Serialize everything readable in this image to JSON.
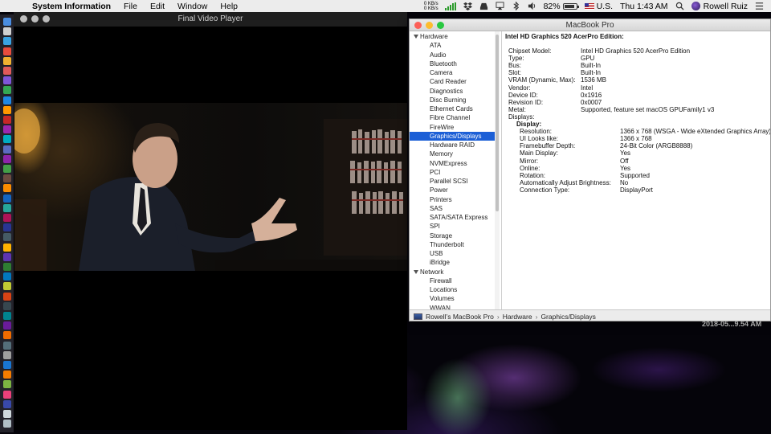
{
  "menubar": {
    "app_name": "System Information",
    "menus": [
      "File",
      "Edit",
      "Window",
      "Help"
    ],
    "net_up": "0 KB/s",
    "net_down": "0 KB/s",
    "battery": "82%",
    "input_source": "U.S.",
    "clock": "Thu 1:43 AM",
    "user": "Rowell Ruiz"
  },
  "video_player": {
    "title": "Final Video Player"
  },
  "sysinfo": {
    "window_title": "MacBook Pro",
    "sidebar": {
      "hardware_label": "Hardware",
      "hardware_items": [
        "ATA",
        "Audio",
        "Bluetooth",
        "Camera",
        "Card Reader",
        "Diagnostics",
        "Disc Burning",
        "Ethernet Cards",
        "Fibre Channel",
        "FireWire",
        "Graphics/Displays",
        "Hardware RAID",
        "Memory",
        "NVMExpress",
        "PCI",
        "Parallel SCSI",
        "Power",
        "Printers",
        "SAS",
        "SATA/SATA Express",
        "SPI",
        "Storage",
        "Thunderbolt",
        "USB",
        "iBridge"
      ],
      "selected": "Graphics/Displays",
      "network_label": "Network",
      "network_items": [
        "Firewall",
        "Locations",
        "Volumes",
        "WWAN"
      ]
    },
    "detail": {
      "heading": "Intel HD Graphics 520 AcerPro Edition:",
      "props": [
        {
          "k": "Chipset Model:",
          "v": "Intel HD Graphics 520 AcerPro Edition"
        },
        {
          "k": "Type:",
          "v": "GPU"
        },
        {
          "k": "Bus:",
          "v": "Built-In"
        },
        {
          "k": "Slot:",
          "v": "Built-In"
        },
        {
          "k": "VRAM (Dynamic, Max):",
          "v": "1536 MB"
        },
        {
          "k": "Vendor:",
          "v": "Intel"
        },
        {
          "k": "Device ID:",
          "v": "0x1916"
        },
        {
          "k": "Revision ID:",
          "v": "0x0007"
        },
        {
          "k": "Metal:",
          "v": "Supported, feature set macOS GPUFamily1 v3"
        },
        {
          "k": "Displays:",
          "v": ""
        }
      ],
      "display_heading": "Display:",
      "display_props": [
        {
          "k": "Resolution:",
          "v": "1366 x 768 (WSGA - Wide eXtended Graphics Array)"
        },
        {
          "k": "UI Looks like:",
          "v": "1366 x 768"
        },
        {
          "k": "Framebuffer Depth:",
          "v": "24-Bit Color (ARGB8888)"
        },
        {
          "k": "Main Display:",
          "v": "Yes"
        },
        {
          "k": "Mirror:",
          "v": "Off"
        },
        {
          "k": "Online:",
          "v": "Yes"
        },
        {
          "k": "Rotation:",
          "v": "Supported"
        },
        {
          "k": "Automatically Adjust Brightness:",
          "v": "No"
        },
        {
          "k": "Connection Type:",
          "v": "DisplayPort"
        }
      ]
    },
    "breadcrumb": [
      "Rowell’s MacBook Pro",
      "Hardware",
      "Graphics/Displays"
    ]
  },
  "wallpaper_date": "2018-05...9.54 AM",
  "colors": {
    "selection": "#1c5fd6",
    "close": "#fc5f57",
    "minimize": "#fdbc2e",
    "zoom": "#28c840"
  }
}
